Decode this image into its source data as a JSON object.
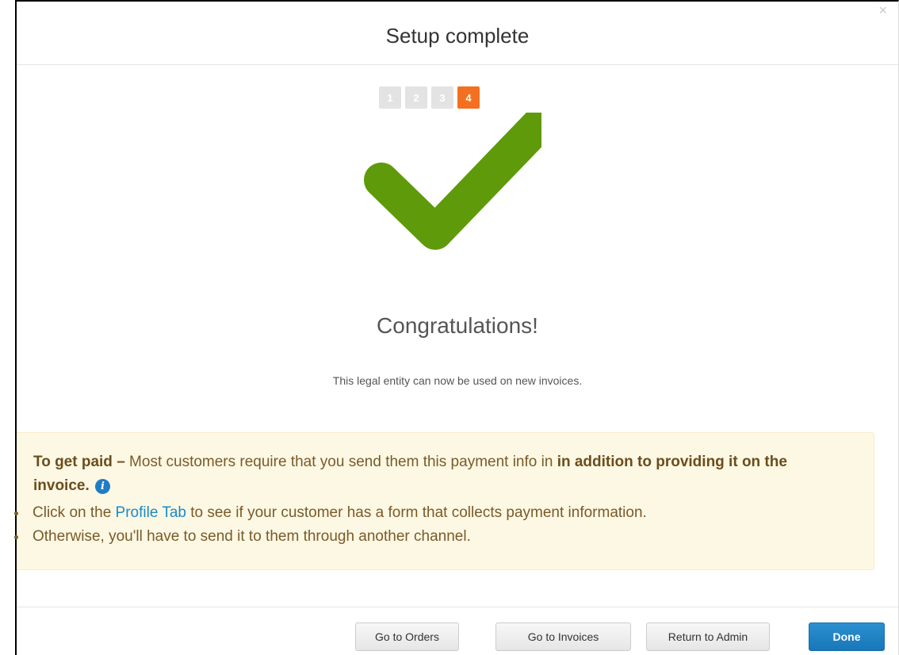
{
  "modal": {
    "title": "Setup complete",
    "close_glyph": "×",
    "steps": [
      "1",
      "2",
      "3",
      "4"
    ],
    "active_step": 4,
    "success_icon": "checkmark-icon",
    "heading": "Congratulations!",
    "message": "This legal entity can now be used on new invoices."
  },
  "alert": {
    "lead": "To get paid –",
    "text": " Most customers require that you send them this payment info in ",
    "emphasis": "in addition to providing it on the invoice.",
    "info_icon": "i",
    "items": {
      "first_prefix": "Click on the ",
      "first_link": "Profile Tab",
      "first_suffix": " to see if your customer has a form that collects payment information.",
      "second": "Otherwise, you'll have to send it to them through another channel."
    }
  },
  "footer": {
    "orders": "Go to Orders",
    "invoices": "Go to Invoices",
    "admin": "Return to Admin",
    "done": "Done"
  },
  "colors": {
    "accent": "#f37021",
    "success": "#5e9a0a",
    "primary": "#1f80c4",
    "alert_bg": "#fdf8e4"
  }
}
